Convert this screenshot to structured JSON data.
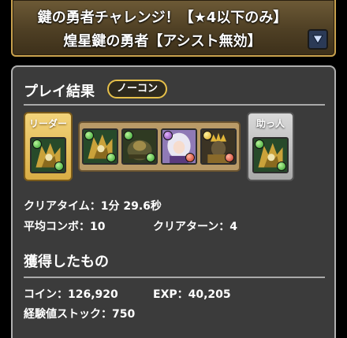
{
  "banner": {
    "title_line1": "鍵の勇者チャレンジ！【★4以下のみ】",
    "title_line2": "煌星鍵の勇者【アシスト無効】",
    "dropdown_icon": "triangle-down-icon"
  },
  "result": {
    "section_title": "プレイ結果",
    "badge": "ノーコン",
    "leader_label": "リーダー",
    "helper_label": "助っ人",
    "team": [
      {
        "role": "leader",
        "frame": "green",
        "attrs": [
          "green",
          "green"
        ]
      },
      {
        "role": "sub",
        "frame": "green",
        "attrs": [
          "green",
          "green"
        ]
      },
      {
        "role": "sub",
        "frame": "green",
        "attrs": [
          "green",
          "green"
        ]
      },
      {
        "role": "sub",
        "frame": "purple",
        "attrs": [
          "purple",
          "red"
        ]
      },
      {
        "role": "sub",
        "frame": "yellow",
        "attrs": [
          "yellow",
          "red"
        ]
      },
      {
        "role": "helper",
        "frame": "green",
        "attrs": [
          "green",
          "green"
        ]
      }
    ],
    "clear_time": "クリアタイム：1分 29.6秒",
    "avg_combo": "平均コンボ：10",
    "clear_turns": "クリアターン：4"
  },
  "rewards": {
    "section_title": "獲得したもの",
    "coin": "コイン：126,920",
    "exp": "EXP：40,205",
    "exp_stock": "経験値ストック：750"
  },
  "colors": {
    "banner_bg": "#4e3f24",
    "banner_border": "#c9a24e",
    "panel_bg": "#3b3b3b",
    "leader_gold": "#e2b95a",
    "sub_tan": "#b99a67",
    "helper_silver": "#c4c4c4",
    "badge_border": "#e7c14a"
  }
}
